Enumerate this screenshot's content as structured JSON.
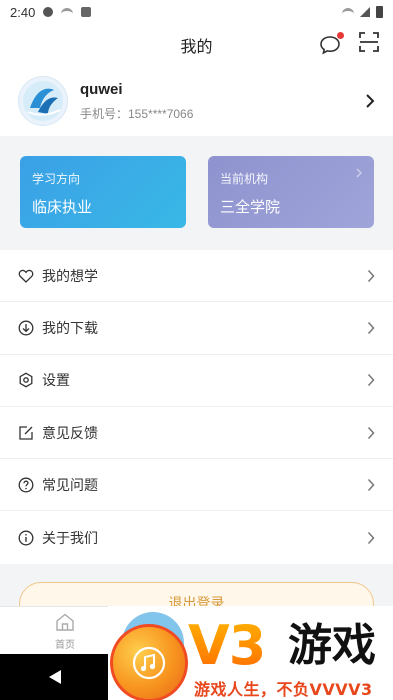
{
  "status_bar": {
    "time": "2:40"
  },
  "header": {
    "title": "我的"
  },
  "profile": {
    "name": "quwei",
    "phone": "手机号：155****7066"
  },
  "cards": {
    "study": {
      "label": "学习方向",
      "value": "临床执业"
    },
    "org": {
      "label": "当前机构",
      "value": "三全学院"
    }
  },
  "menu": [
    {
      "label": "我的想学",
      "icon": "heart-icon"
    },
    {
      "label": "我的下载",
      "icon": "download-icon"
    },
    {
      "label": "设置",
      "icon": "settings-icon"
    },
    {
      "label": "意见反馈",
      "icon": "edit-icon"
    },
    {
      "label": "常见问题",
      "icon": "question-icon"
    },
    {
      "label": "关于我们",
      "icon": "info-icon"
    }
  ],
  "logout": {
    "label": "退出登录"
  },
  "tabbar": {
    "home_label": "首页"
  },
  "watermark": {
    "brand": "V3",
    "brand_cn": "游戏",
    "slogan": "游戏人生，不负VVVV3"
  },
  "colors": {
    "accent": "#3aa0e6",
    "org_card": "#8e93cf",
    "notify_dot": "#e53935",
    "logout_text": "#d89a3c"
  }
}
